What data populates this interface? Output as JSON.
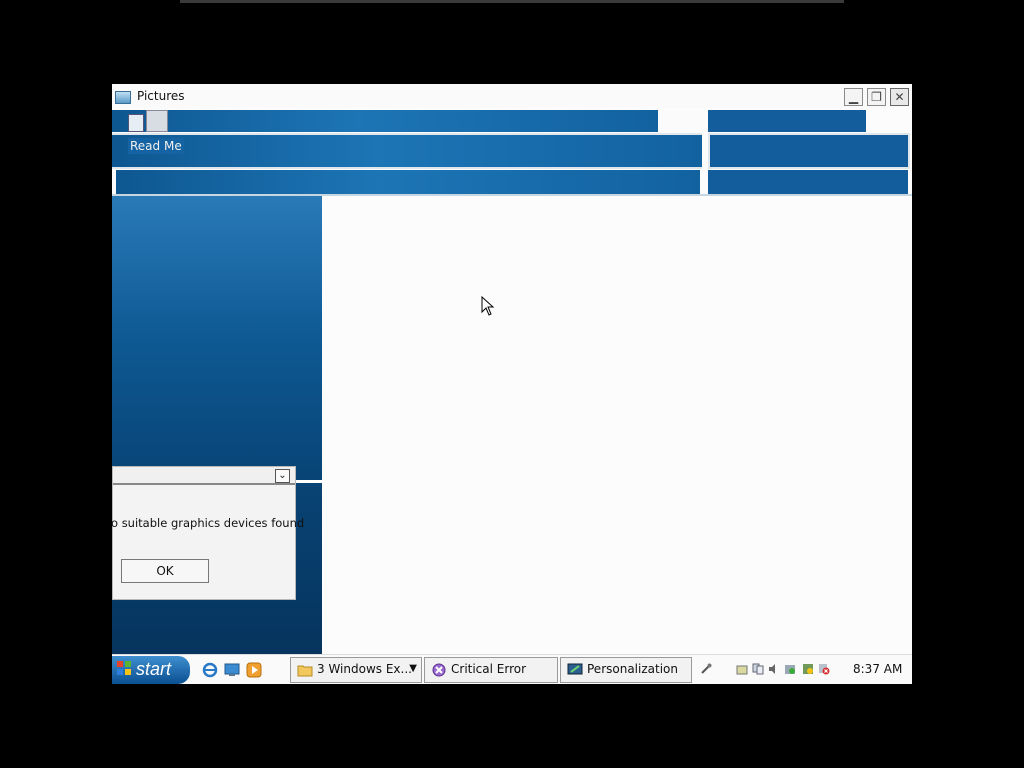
{
  "window": {
    "title": "Pictures",
    "file_label": "Read Me"
  },
  "dialog": {
    "message": "o suitable graphics devices found",
    "ok_label": "OK"
  },
  "taskbar": {
    "start_label": "start",
    "tasks": [
      {
        "label": "3 Windows Ex..."
      },
      {
        "label": "Critical Error"
      },
      {
        "label": "Personalization"
      }
    ],
    "clock": "8:37 AM"
  },
  "icons": {
    "title": "pictures-folder-icon",
    "minimize": "minimize-icon",
    "maximize": "maximize-icon",
    "close": "close-icon",
    "start": "windows-flag-icon",
    "ie": "internet-explorer-icon",
    "desktop": "show-desktop-icon",
    "media": "media-player-icon"
  },
  "colors": {
    "accent": "#0c4a7d",
    "band": "#1d75b5",
    "taskbar": "#fafafa"
  }
}
